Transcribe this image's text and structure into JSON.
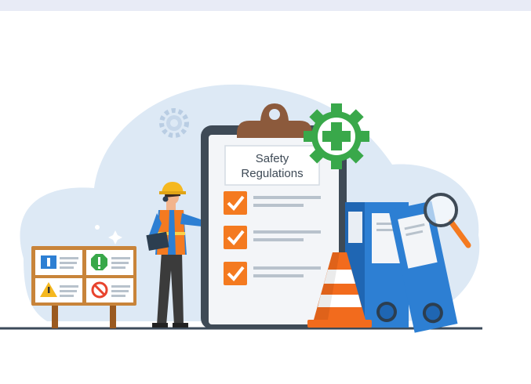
{
  "illustration": {
    "clipboard_title_line1": "Safety",
    "clipboard_title_line2": "Regulations",
    "checklist_items_checked": 3,
    "colors": {
      "blob": "#dce8f4",
      "clipboard_frame": "#3e4a56",
      "clip": "#8c5a3c",
      "check_orange": "#f47a20",
      "gear_green": "#39a84a",
      "binder_blue": "#2d7fd3",
      "cone_orange": "#f26b1d",
      "ground_line": "#3b4a5a",
      "sign_board": "#c87a2e"
    }
  }
}
